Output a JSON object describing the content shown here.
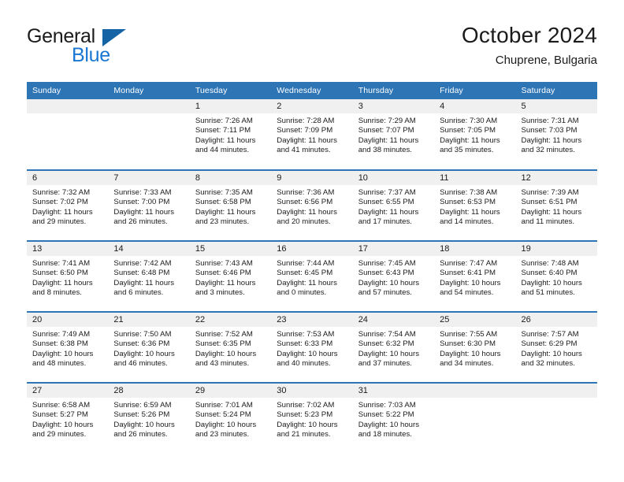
{
  "brand": {
    "line1": "General",
    "line2": "Blue",
    "icon": "triangle-logo",
    "color_general": "#1b1b1b",
    "color_blue": "#1877d2",
    "color_triangle": "#1464a5"
  },
  "header": {
    "title": "October 2024",
    "subtitle": "Chuprene, Bulgaria"
  },
  "theme": {
    "header_blue": "#2e75b6",
    "daynum_gray": "#f0f0f0",
    "text": "#1b1b1b"
  },
  "calendar": {
    "weekday_headers": [
      "Sunday",
      "Monday",
      "Tuesday",
      "Wednesday",
      "Thursday",
      "Friday",
      "Saturday"
    ],
    "labels": {
      "sunrise": "Sunrise:",
      "sunset": "Sunset:",
      "daylight": "Daylight:"
    },
    "weeks": [
      [
        {
          "day": "",
          "sunrise": "",
          "sunset": "",
          "daylight_a": "",
          "daylight_b": ""
        },
        {
          "day": "",
          "sunrise": "",
          "sunset": "",
          "daylight_a": "",
          "daylight_b": ""
        },
        {
          "day": "1",
          "sunrise": "Sunrise: 7:26 AM",
          "sunset": "Sunset: 7:11 PM",
          "daylight_a": "Daylight: 11 hours",
          "daylight_b": "and 44 minutes."
        },
        {
          "day": "2",
          "sunrise": "Sunrise: 7:28 AM",
          "sunset": "Sunset: 7:09 PM",
          "daylight_a": "Daylight: 11 hours",
          "daylight_b": "and 41 minutes."
        },
        {
          "day": "3",
          "sunrise": "Sunrise: 7:29 AM",
          "sunset": "Sunset: 7:07 PM",
          "daylight_a": "Daylight: 11 hours",
          "daylight_b": "and 38 minutes."
        },
        {
          "day": "4",
          "sunrise": "Sunrise: 7:30 AM",
          "sunset": "Sunset: 7:05 PM",
          "daylight_a": "Daylight: 11 hours",
          "daylight_b": "and 35 minutes."
        },
        {
          "day": "5",
          "sunrise": "Sunrise: 7:31 AM",
          "sunset": "Sunset: 7:03 PM",
          "daylight_a": "Daylight: 11 hours",
          "daylight_b": "and 32 minutes."
        }
      ],
      [
        {
          "day": "6",
          "sunrise": "Sunrise: 7:32 AM",
          "sunset": "Sunset: 7:02 PM",
          "daylight_a": "Daylight: 11 hours",
          "daylight_b": "and 29 minutes."
        },
        {
          "day": "7",
          "sunrise": "Sunrise: 7:33 AM",
          "sunset": "Sunset: 7:00 PM",
          "daylight_a": "Daylight: 11 hours",
          "daylight_b": "and 26 minutes."
        },
        {
          "day": "8",
          "sunrise": "Sunrise: 7:35 AM",
          "sunset": "Sunset: 6:58 PM",
          "daylight_a": "Daylight: 11 hours",
          "daylight_b": "and 23 minutes."
        },
        {
          "day": "9",
          "sunrise": "Sunrise: 7:36 AM",
          "sunset": "Sunset: 6:56 PM",
          "daylight_a": "Daylight: 11 hours",
          "daylight_b": "and 20 minutes."
        },
        {
          "day": "10",
          "sunrise": "Sunrise: 7:37 AM",
          "sunset": "Sunset: 6:55 PM",
          "daylight_a": "Daylight: 11 hours",
          "daylight_b": "and 17 minutes."
        },
        {
          "day": "11",
          "sunrise": "Sunrise: 7:38 AM",
          "sunset": "Sunset: 6:53 PM",
          "daylight_a": "Daylight: 11 hours",
          "daylight_b": "and 14 minutes."
        },
        {
          "day": "12",
          "sunrise": "Sunrise: 7:39 AM",
          "sunset": "Sunset: 6:51 PM",
          "daylight_a": "Daylight: 11 hours",
          "daylight_b": "and 11 minutes."
        }
      ],
      [
        {
          "day": "13",
          "sunrise": "Sunrise: 7:41 AM",
          "sunset": "Sunset: 6:50 PM",
          "daylight_a": "Daylight: 11 hours",
          "daylight_b": "and 8 minutes."
        },
        {
          "day": "14",
          "sunrise": "Sunrise: 7:42 AM",
          "sunset": "Sunset: 6:48 PM",
          "daylight_a": "Daylight: 11 hours",
          "daylight_b": "and 6 minutes."
        },
        {
          "day": "15",
          "sunrise": "Sunrise: 7:43 AM",
          "sunset": "Sunset: 6:46 PM",
          "daylight_a": "Daylight: 11 hours",
          "daylight_b": "and 3 minutes."
        },
        {
          "day": "16",
          "sunrise": "Sunrise: 7:44 AM",
          "sunset": "Sunset: 6:45 PM",
          "daylight_a": "Daylight: 11 hours",
          "daylight_b": "and 0 minutes."
        },
        {
          "day": "17",
          "sunrise": "Sunrise: 7:45 AM",
          "sunset": "Sunset: 6:43 PM",
          "daylight_a": "Daylight: 10 hours",
          "daylight_b": "and 57 minutes."
        },
        {
          "day": "18",
          "sunrise": "Sunrise: 7:47 AM",
          "sunset": "Sunset: 6:41 PM",
          "daylight_a": "Daylight: 10 hours",
          "daylight_b": "and 54 minutes."
        },
        {
          "day": "19",
          "sunrise": "Sunrise: 7:48 AM",
          "sunset": "Sunset: 6:40 PM",
          "daylight_a": "Daylight: 10 hours",
          "daylight_b": "and 51 minutes."
        }
      ],
      [
        {
          "day": "20",
          "sunrise": "Sunrise: 7:49 AM",
          "sunset": "Sunset: 6:38 PM",
          "daylight_a": "Daylight: 10 hours",
          "daylight_b": "and 48 minutes."
        },
        {
          "day": "21",
          "sunrise": "Sunrise: 7:50 AM",
          "sunset": "Sunset: 6:36 PM",
          "daylight_a": "Daylight: 10 hours",
          "daylight_b": "and 46 minutes."
        },
        {
          "day": "22",
          "sunrise": "Sunrise: 7:52 AM",
          "sunset": "Sunset: 6:35 PM",
          "daylight_a": "Daylight: 10 hours",
          "daylight_b": "and 43 minutes."
        },
        {
          "day": "23",
          "sunrise": "Sunrise: 7:53 AM",
          "sunset": "Sunset: 6:33 PM",
          "daylight_a": "Daylight: 10 hours",
          "daylight_b": "and 40 minutes."
        },
        {
          "day": "24",
          "sunrise": "Sunrise: 7:54 AM",
          "sunset": "Sunset: 6:32 PM",
          "daylight_a": "Daylight: 10 hours",
          "daylight_b": "and 37 minutes."
        },
        {
          "day": "25",
          "sunrise": "Sunrise: 7:55 AM",
          "sunset": "Sunset: 6:30 PM",
          "daylight_a": "Daylight: 10 hours",
          "daylight_b": "and 34 minutes."
        },
        {
          "day": "26",
          "sunrise": "Sunrise: 7:57 AM",
          "sunset": "Sunset: 6:29 PM",
          "daylight_a": "Daylight: 10 hours",
          "daylight_b": "and 32 minutes."
        }
      ],
      [
        {
          "day": "27",
          "sunrise": "Sunrise: 6:58 AM",
          "sunset": "Sunset: 5:27 PM",
          "daylight_a": "Daylight: 10 hours",
          "daylight_b": "and 29 minutes."
        },
        {
          "day": "28",
          "sunrise": "Sunrise: 6:59 AM",
          "sunset": "Sunset: 5:26 PM",
          "daylight_a": "Daylight: 10 hours",
          "daylight_b": "and 26 minutes."
        },
        {
          "day": "29",
          "sunrise": "Sunrise: 7:01 AM",
          "sunset": "Sunset: 5:24 PM",
          "daylight_a": "Daylight: 10 hours",
          "daylight_b": "and 23 minutes."
        },
        {
          "day": "30",
          "sunrise": "Sunrise: 7:02 AM",
          "sunset": "Sunset: 5:23 PM",
          "daylight_a": "Daylight: 10 hours",
          "daylight_b": "and 21 minutes."
        },
        {
          "day": "31",
          "sunrise": "Sunrise: 7:03 AM",
          "sunset": "Sunset: 5:22 PM",
          "daylight_a": "Daylight: 10 hours",
          "daylight_b": "and 18 minutes."
        },
        {
          "day": "",
          "sunrise": "",
          "sunset": "",
          "daylight_a": "",
          "daylight_b": ""
        },
        {
          "day": "",
          "sunrise": "",
          "sunset": "",
          "daylight_a": "",
          "daylight_b": ""
        }
      ]
    ]
  }
}
